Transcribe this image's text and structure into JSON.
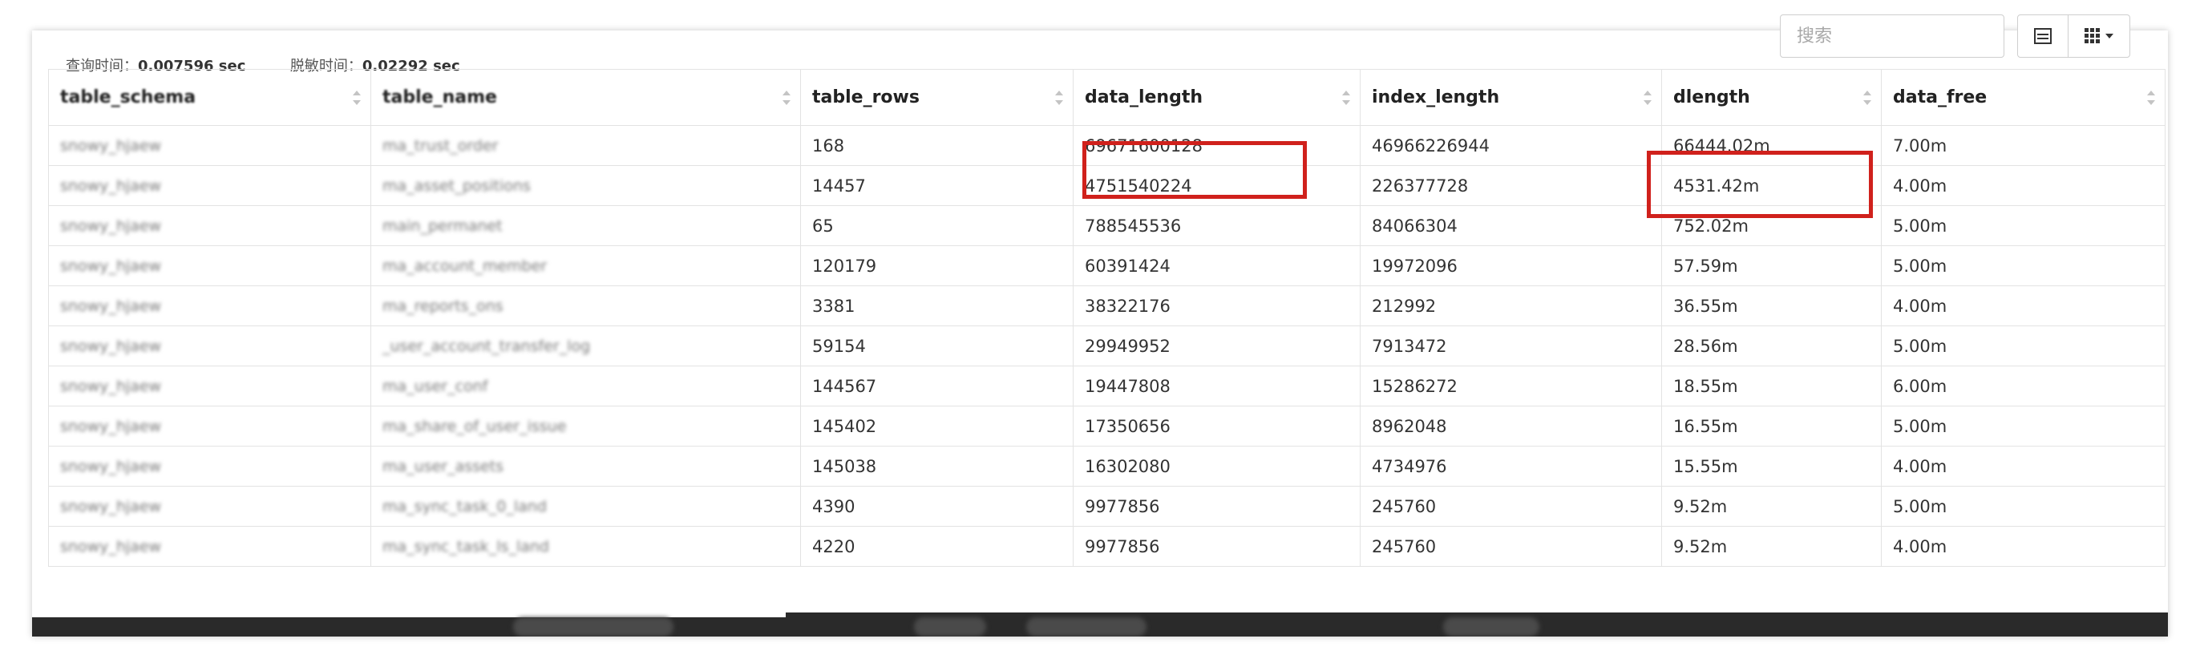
{
  "status": {
    "query_time_label": "查询时间：",
    "query_time_value": "0.007596 sec",
    "mask_time_label": "脱敏时间：",
    "mask_time_value": "0.02292 sec"
  },
  "toolbar": {
    "search_placeholder": "搜索",
    "table_view_icon": "table-icon",
    "columns_icon": "grid-icon"
  },
  "table": {
    "columns": [
      "table_schema",
      "table_name",
      "table_rows",
      "data_length",
      "index_length",
      "dlength",
      "data_free"
    ],
    "rows": [
      {
        "table_schema": "snowy_hjaew",
        "table_name": "ma_trust_order",
        "table_rows": "168",
        "data_length": "69671600128",
        "index_length": "46966226944",
        "dlength": "66444.02m",
        "data_free": "7.00m"
      },
      {
        "table_schema": "snowy_hjaew",
        "table_name": "ma_asset_positions",
        "table_rows": "14457",
        "data_length": "4751540224",
        "index_length": "226377728",
        "dlength": "4531.42m",
        "data_free": "4.00m"
      },
      {
        "table_schema": "snowy_hjaew",
        "table_name": "main_permanet",
        "table_rows": "65",
        "data_length": "788545536",
        "index_length": "84066304",
        "dlength": "752.02m",
        "data_free": "5.00m"
      },
      {
        "table_schema": "snowy_hjaew",
        "table_name": "ma_account_member",
        "table_rows": "120179",
        "data_length": "60391424",
        "index_length": "19972096",
        "dlength": "57.59m",
        "data_free": "5.00m"
      },
      {
        "table_schema": "snowy_hjaew",
        "table_name": "ma_reports_ons",
        "table_rows": "3381",
        "data_length": "38322176",
        "index_length": "212992",
        "dlength": "36.55m",
        "data_free": "4.00m"
      },
      {
        "table_schema": "snowy_hjaew",
        "table_name": "_user_account_transfer_log",
        "table_rows": "59154",
        "data_length": "29949952",
        "index_length": "7913472",
        "dlength": "28.56m",
        "data_free": "5.00m"
      },
      {
        "table_schema": "snowy_hjaew",
        "table_name": "ma_user_conf",
        "table_rows": "144567",
        "data_length": "19447808",
        "index_length": "15286272",
        "dlength": "18.55m",
        "data_free": "6.00m"
      },
      {
        "table_schema": "snowy_hjaew",
        "table_name": "ma_share_of_user_issue",
        "table_rows": "145402",
        "data_length": "17350656",
        "index_length": "8962048",
        "dlength": "16.55m",
        "data_free": "5.00m"
      },
      {
        "table_schema": "snowy_hjaew",
        "table_name": "ma_user_assets",
        "table_rows": "145038",
        "data_length": "16302080",
        "index_length": "4734976",
        "dlength": "15.55m",
        "data_free": "4.00m"
      },
      {
        "table_schema": "snowy_hjaew",
        "table_name": "ma_sync_task_0_land",
        "table_rows": "4390",
        "data_length": "9977856",
        "index_length": "245760",
        "dlength": "9.52m",
        "data_free": "5.00m"
      },
      {
        "table_schema": "snowy_hjaew",
        "table_name": "ma_sync_task_ls_land",
        "table_rows": "4220",
        "data_length": "9977856",
        "index_length": "245760",
        "dlength": "9.52m",
        "data_free": "4.00m"
      }
    ]
  },
  "colors": {
    "highlight": "#d0211c",
    "border": "#e3e3e3",
    "footer": "#2a2a2a"
  }
}
